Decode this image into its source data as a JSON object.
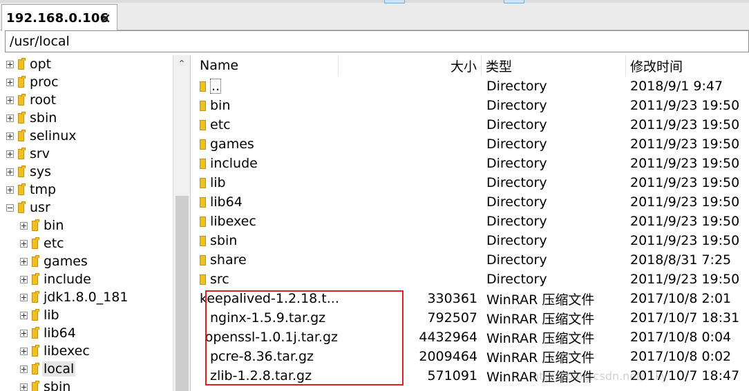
{
  "tab": {
    "title": "192.168.0.106",
    "close_glyph": "×"
  },
  "path": {
    "value": "/usr/local"
  },
  "tree": {
    "items": [
      {
        "label": "opt",
        "level": 0,
        "expander": "plus"
      },
      {
        "label": "proc",
        "level": 0,
        "expander": "plus"
      },
      {
        "label": "root",
        "level": 0,
        "expander": "plus"
      },
      {
        "label": "sbin",
        "level": 0,
        "expander": "plus"
      },
      {
        "label": "selinux",
        "level": 0,
        "expander": "plus"
      },
      {
        "label": "srv",
        "level": 0,
        "expander": "plus"
      },
      {
        "label": "sys",
        "level": 0,
        "expander": "plus"
      },
      {
        "label": "tmp",
        "level": 0,
        "expander": "plus"
      },
      {
        "label": "usr",
        "level": 0,
        "expander": "minus"
      },
      {
        "label": "bin",
        "level": 1,
        "expander": "plus"
      },
      {
        "label": "etc",
        "level": 1,
        "expander": "plus"
      },
      {
        "label": "games",
        "level": 1,
        "expander": "plus"
      },
      {
        "label": "include",
        "level": 1,
        "expander": "plus"
      },
      {
        "label": "jdk1.8.0_181",
        "level": 1,
        "expander": "plus"
      },
      {
        "label": "lib",
        "level": 1,
        "expander": "plus"
      },
      {
        "label": "lib64",
        "level": 1,
        "expander": "plus"
      },
      {
        "label": "libexec",
        "level": 1,
        "expander": "plus"
      },
      {
        "label": "local",
        "level": 1,
        "expander": "plus",
        "selected": true
      },
      {
        "label": "sbin",
        "level": 1,
        "expander": "plus"
      }
    ]
  },
  "columns": {
    "name": "Name",
    "size": "大小",
    "type": "类型",
    "modified": "修改时间"
  },
  "files": [
    {
      "name": "..",
      "size": "",
      "type": "Directory",
      "modified": "2018/9/1 9:47",
      "icon": "folder-icon"
    },
    {
      "name": "bin",
      "size": "",
      "type": "Directory",
      "modified": "2011/9/23 19:50",
      "icon": "folder-icon"
    },
    {
      "name": "etc",
      "size": "",
      "type": "Directory",
      "modified": "2011/9/23 19:50",
      "icon": "folder-icon"
    },
    {
      "name": "games",
      "size": "",
      "type": "Directory",
      "modified": "2011/9/23 19:50",
      "icon": "folder-icon"
    },
    {
      "name": "include",
      "size": "",
      "type": "Directory",
      "modified": "2011/9/23 19:50",
      "icon": "folder-icon"
    },
    {
      "name": "lib",
      "size": "",
      "type": "Directory",
      "modified": "2011/9/23 19:50",
      "icon": "folder-icon"
    },
    {
      "name": "lib64",
      "size": "",
      "type": "Directory",
      "modified": "2011/9/23 19:50",
      "icon": "folder-icon"
    },
    {
      "name": "libexec",
      "size": "",
      "type": "Directory",
      "modified": "2011/9/23 19:50",
      "icon": "folder-icon"
    },
    {
      "name": "sbin",
      "size": "",
      "type": "Directory",
      "modified": "2011/9/23 19:50",
      "icon": "folder-icon"
    },
    {
      "name": "share",
      "size": "",
      "type": "Directory",
      "modified": "2018/8/31 7:25",
      "icon": "folder-icon"
    },
    {
      "name": "src",
      "size": "",
      "type": "Directory",
      "modified": "2011/9/23 19:50",
      "icon": "folder-icon"
    },
    {
      "name": "keepalived-1.2.18.t...",
      "size": "330361",
      "type": "WinRAR 压缩文件",
      "modified": "2017/10/8 2:01",
      "icon": ""
    },
    {
      "name": "nginx-1.5.9.tar.gz",
      "size": "792507",
      "type": "WinRAR 压缩文件",
      "modified": "2017/10/7 18:31",
      "icon": ""
    },
    {
      "name": "openssl-1.0.1j.tar.gz",
      "size": "4432964",
      "type": "WinRAR 压缩文件",
      "modified": "2017/10/8 0:04",
      "icon": ""
    },
    {
      "name": "pcre-8.36.tar.gz",
      "size": "2009464",
      "type": "WinRAR 压缩文件",
      "modified": "2017/10/8 0:02",
      "icon": ""
    },
    {
      "name": "zlib-1.2.8.tar.gz",
      "size": "571091",
      "type": "WinRAR 压缩文件",
      "modified": "2017/10/7 18:47",
      "icon": ""
    }
  ],
  "watermark": "http://blog.csdn.net/...ky"
}
